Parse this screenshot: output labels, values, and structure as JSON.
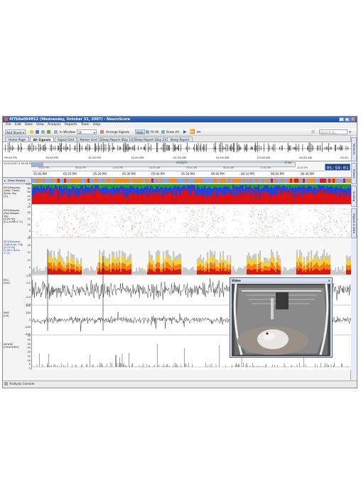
{
  "window": {
    "title": "4f7b8a094ff12 (Wednesday, October 31, 2007) - NeuroScore"
  },
  "menu": [
    "File",
    "Edit",
    "Data",
    "View",
    "Analysis",
    "Reports",
    "Tools",
    "Help"
  ],
  "toolbar": {
    "add_sheet": "Add Sheet",
    "in_window_label": "In Window",
    "in_window_value": "2h",
    "arrange_signals": "Arrange Signals",
    "auto": "Auto",
    "fit_all": "Fit All",
    "scale_all": "Scale All",
    "search_placeholder": "Search Fo..."
  },
  "tabs": [
    "Home Page",
    "All Signals",
    "Signal Grid",
    "Marker Grid",
    "Sleep Report (Day 1)",
    "Sleep Report (Day 2)",
    "Sleep Report"
  ],
  "right_panel": [
    "Markers",
    "Events",
    "Scoring",
    "Signals & Data"
  ],
  "overview_times": [
    "09:00 PM",
    "10:00 PM",
    "11:00 PM",
    "12:00 AM",
    "01:00 AM",
    "02:00 AM",
    "03:00 AM",
    "04:00 AM",
    "05:00"
  ],
  "nav": {
    "start": "10/31/2007 4:55:48 PM",
    "small_times": [
      "05:00 PM",
      "08:00 PM",
      "11:00 PM",
      "02:00 AM",
      "05:00 AM",
      "08:00 AM",
      "11:00 AM",
      "02:00 PM"
    ],
    "mid_label": "07/02/07",
    "right_label": "17:50",
    "main_times": [
      "05:00 PM",
      "05:10 PM",
      "05:20 PM",
      "05:30 PM",
      "05:40 PM",
      "05:50 PM",
      "06:00 PM",
      "06:10 PM",
      "06:20 PM",
      "06:30 PM",
      "06:40 PM"
    ],
    "clock": "05:59:01"
  },
  "channels": [
    {
      "label": "Sleep Staging",
      "ticks": []
    },
    {
      "label": "EEG(Bregma)\nDelta, Theta,\nAlpha, Sig\n[%]",
      "ticks": [
        "100",
        "80",
        "60",
        "40",
        "20",
        "0"
      ]
    },
    {
      "label": "EEG(Bregma\n(Pseudospec.\nSig)\n[0-25 Hz]\n[0.2.4 MB V^2]",
      "ticks": [
        "25",
        "20",
        "15",
        "10",
        "5",
        "0"
      ]
    },
    {
      "label": "EEG(Bregma)\n(Spectrum, Sig)\n[0-25 Hz]\n[0-46.4 Nano\nV^2]",
      "ticks": [
        "25",
        "20",
        "15",
        "10",
        "5",
        "0"
      ]
    },
    {
      "label": "EEG\n[mV]",
      "ticks": [
        "0.4",
        "0.2",
        "0",
        "-0.2",
        "-0.4"
      ]
    },
    {
      "label": "EMG\n[uV]",
      "ticks": [
        "400",
        "200",
        "0",
        "-200",
        "-400"
      ]
    },
    {
      "label": "Activity\n[Counts/bin]",
      "ticks": [
        "40",
        "35",
        "30",
        "25",
        "20",
        "15",
        "10",
        "5",
        "0"
      ]
    }
  ],
  "video": {
    "title": "Video"
  },
  "status": {
    "console": "Analysis Console"
  },
  "colors": {
    "titlebar": "#1f4ea0",
    "clock_bg": "#1b3e82",
    "stage_orange": "#f58a1f",
    "stage_blue": "#8fa4e8",
    "stage_red": "#e02020",
    "delta": "#e01010",
    "theta": "#2040e0",
    "alpha": "#20a020"
  }
}
